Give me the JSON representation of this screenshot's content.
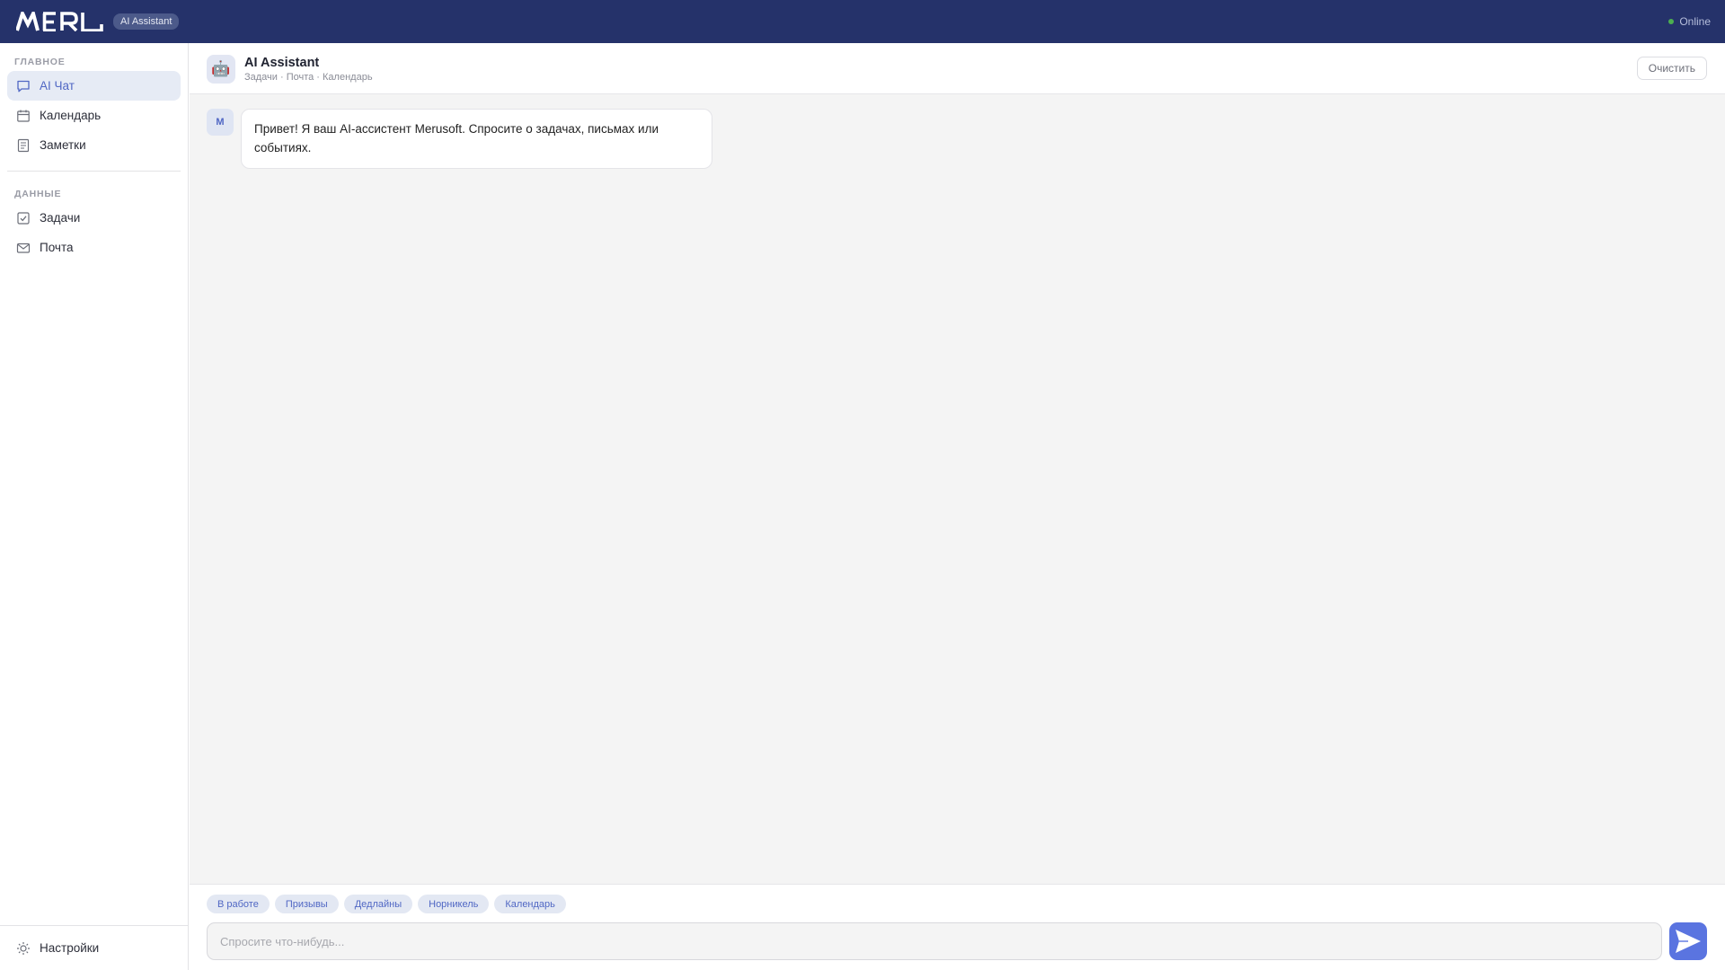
{
  "topbar": {
    "logo_text": "MERL",
    "app_badge": "AI Assistant",
    "status": "Online",
    "status_color": "#4caf50",
    "background": "#25326a"
  },
  "sidebar": {
    "sections": [
      {
        "label": "ГЛАВНОЕ",
        "items": [
          {
            "label": "AI Чат",
            "icon": "chat-bubble-icon",
            "active": true
          },
          {
            "label": "Календарь",
            "icon": "calendar-icon",
            "active": false
          },
          {
            "label": "Заметки",
            "icon": "notes-icon",
            "active": false
          }
        ]
      },
      {
        "label": "ДАННЫЕ",
        "items": [
          {
            "label": "Задачи",
            "icon": "checkbox-icon",
            "active": false
          },
          {
            "label": "Почта",
            "icon": "mail-icon",
            "active": false
          }
        ]
      }
    ],
    "settings_label": "Настройки",
    "settings_icon": "sun-gear-icon"
  },
  "chat": {
    "title": "AI Assistant",
    "subtitle": "Задачи · Почта · Календарь",
    "bot_icon": "robot-icon",
    "clear_label": "Очистить",
    "messages": [
      {
        "author_initial": "M",
        "text": "Привет! Я ваш AI-ассистент Merusoft. Спросите о задачах, письмах или событиях."
      }
    ]
  },
  "composer": {
    "chips": [
      "В работе",
      "Призывы",
      "Дедлайны",
      "Норникель",
      "Календарь"
    ],
    "placeholder": "Спросите что-нибудь...",
    "value": "",
    "send_icon": "send-arrow-icon",
    "accent": "#5a74e0"
  }
}
